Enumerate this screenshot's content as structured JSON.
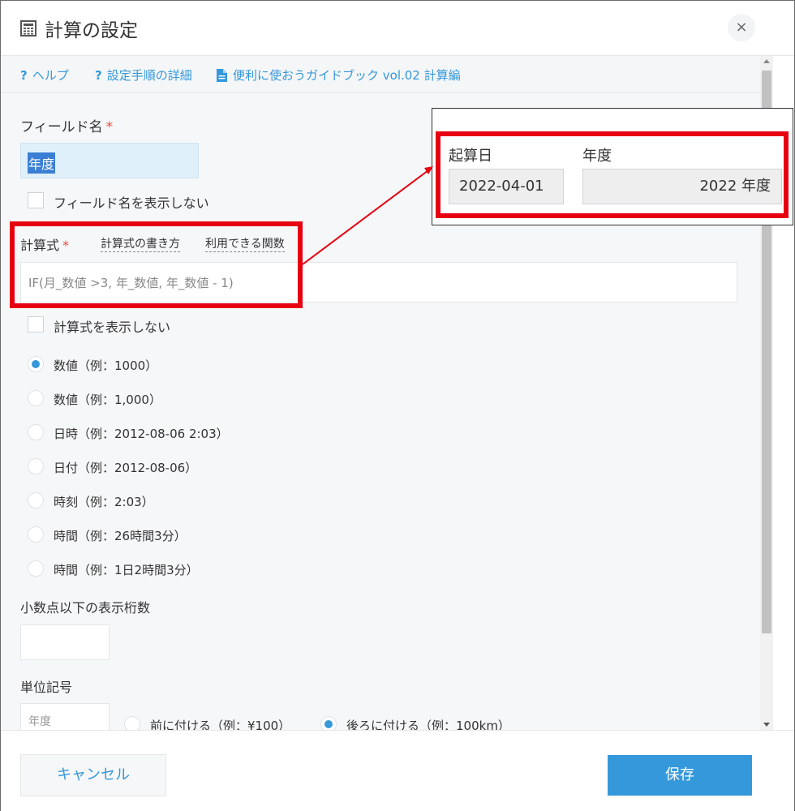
{
  "header": {
    "title": "計算の設定",
    "close_label": "×"
  },
  "links": {
    "help": "ヘルプ",
    "setup_detail": "設定手順の詳細",
    "guidebook": "便利に使おうガイドブック vol.02 計算編"
  },
  "form": {
    "field_name_label": "フィールド名",
    "required_mark": "*",
    "field_name_value": "年度",
    "hide_field_name_label": "フィールド名を表示しない",
    "formula_label": "計算式",
    "formula_howto_link": "計算式の書き方",
    "formula_functions_link": "利用できる関数",
    "formula_value": "IF(月_数値 >3, 年_数値, 年_数値 - 1)",
    "hide_formula_label": "計算式を表示しない",
    "format_options": [
      {
        "label": "数値（例：1000）",
        "selected": true
      },
      {
        "label": "数値（例：1,000）",
        "selected": false
      },
      {
        "label": "日時（例：2012-08-06 2:03）",
        "selected": false
      },
      {
        "label": "日付（例：2012-08-06）",
        "selected": false
      },
      {
        "label": "時刻（例：2:03）",
        "selected": false
      },
      {
        "label": "時間（例：26時間3分）",
        "selected": false
      },
      {
        "label": "時間（例：1日2時間3分）",
        "selected": false
      }
    ],
    "decimal_label": "小数点以下の表示桁数",
    "decimal_value": "",
    "unit_label": "単位記号",
    "unit_placeholder": "年度",
    "unit_position_options": [
      {
        "label": "前に付ける（例：¥100）",
        "selected": false
      },
      {
        "label": "後ろに付ける（例：100km）",
        "selected": true
      }
    ]
  },
  "footer": {
    "cancel_label": "キャンセル",
    "save_label": "保存"
  },
  "preview": {
    "start_date_label": "起算日",
    "start_date_value": "2022-04-01",
    "fiscal_year_label": "年度",
    "fiscal_year_value": "2022 年度"
  },
  "colors": {
    "accent": "#3498db",
    "required": "#e74c3c",
    "annotation_red": "#e60012"
  }
}
